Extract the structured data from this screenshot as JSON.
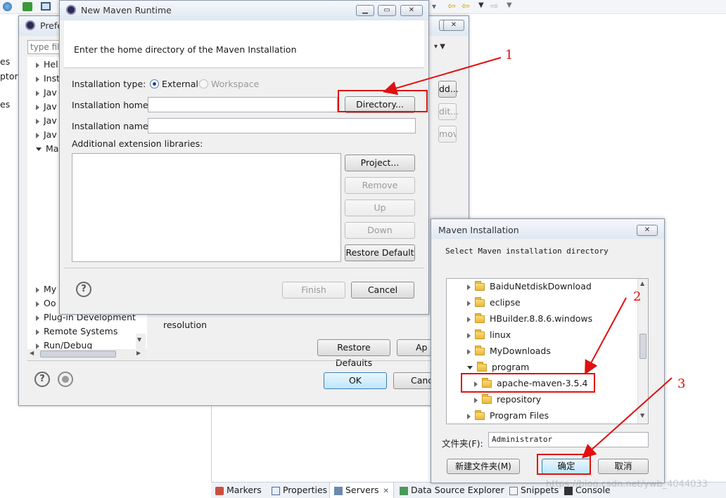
{
  "background_ide": {
    "left_cut_texts": [
      "es",
      "ptor:",
      "es"
    ],
    "bottom_tabs": [
      {
        "label": "Markers",
        "icon": "markers-icon"
      },
      {
        "label": "Properties",
        "icon": "properties-icon"
      },
      {
        "label": "Servers",
        "icon": "servers-icon"
      },
      {
        "label": "Data Source Explorer",
        "icon": "data-source-icon"
      },
      {
        "label": "Snippets",
        "icon": "snippets-icon"
      },
      {
        "label": "Console",
        "icon": "console-icon"
      }
    ],
    "servers_close": "✕"
  },
  "preferences": {
    "title": "Prefe",
    "filter_placeholder": "type fil",
    "tree_top": [
      "Hel",
      "Inst",
      "Jav",
      "Jav",
      "Jav",
      "Jav",
      "Ma"
    ],
    "tree_bottom": [
      "My",
      "Oo",
      "Plug-in Development",
      "Remote Systems",
      "Run/Debug"
    ],
    "right_buttons": [
      "dd...",
      "dit...",
      "move"
    ],
    "resolution_text": "resolution",
    "restore_defaults": "Restore Defaults",
    "apply": "Ap",
    "ok": "OK",
    "cancel": "Canc"
  },
  "new_maven_runtime": {
    "title": "New Maven Runtime",
    "header_text": "Enter the home directory of the Maven Installation",
    "installation_type_label": "Installation type:",
    "radio_external": "External",
    "radio_workspace": "Workspace",
    "installation_home_label": "Installation home:",
    "installation_home_value": "",
    "directory_button": "Directory...",
    "installation_name_label": "Installation name:",
    "installation_name_value": "",
    "additional_libraries_label": "Additional extension libraries:",
    "project_button": "Project...",
    "remove_button": "Remove",
    "up_button": "Up",
    "down_button": "Down",
    "restore_default_button": "Restore Default",
    "finish_button": "Finish",
    "cancel_button": "Cancel"
  },
  "maven_installation": {
    "title": "Maven Installation",
    "prompt": "Select Maven installation directory",
    "folders": [
      {
        "name": "BaiduNetdiskDownload",
        "level": 0,
        "expanded": false
      },
      {
        "name": "eclipse",
        "level": 0,
        "expanded": false
      },
      {
        "name": "HBuilder.8.8.6.windows",
        "level": 0,
        "expanded": false
      },
      {
        "name": "linux",
        "level": 0,
        "expanded": false
      },
      {
        "name": "MyDownloads",
        "level": 0,
        "expanded": false
      },
      {
        "name": "program",
        "level": 0,
        "expanded": true
      },
      {
        "name": "apache-maven-3.5.4",
        "level": 1,
        "expanded": false
      },
      {
        "name": "repository",
        "level": 1,
        "expanded": false
      },
      {
        "name": "Program Files",
        "level": 0,
        "expanded": false
      }
    ],
    "folder_label": "文件夹(F):",
    "folder_value": "Administrator",
    "new_folder_button": "新建文件夹(M)",
    "ok_button": "确定",
    "cancel_button": "取消"
  },
  "annotations": [
    "1",
    "2",
    "3"
  ],
  "watermark": "https://blog.csdn.net/ywb_4044033",
  "colors": {
    "annotation_red": "#e01010",
    "selection_blue": "#3c7fb1"
  }
}
